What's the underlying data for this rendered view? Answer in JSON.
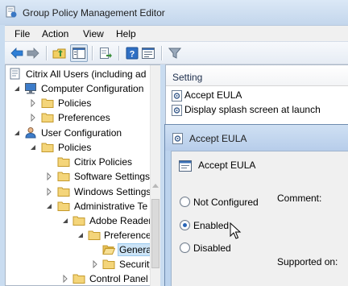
{
  "window": {
    "title": "Group Policy Management Editor"
  },
  "menu": {
    "items": [
      "File",
      "Action",
      "View",
      "Help"
    ]
  },
  "toolbar": {
    "buttons": [
      "back-arrow-icon",
      "forward-arrow-icon",
      "up-folder-icon",
      "show-hide-tree-icon",
      "export-list-icon",
      "help-icon",
      "properties-icon",
      "filter-icon"
    ]
  },
  "tree": {
    "items": [
      {
        "label": "Citrix All Users (including ad",
        "icon": "policy-scroll-icon",
        "expanded": true
      },
      {
        "label": "Computer Configuration",
        "icon": "computer-icon",
        "expanded": true
      },
      {
        "label": "Policies",
        "icon": "folder-icon",
        "expanded": false
      },
      {
        "label": "Preferences",
        "icon": "folder-icon",
        "expanded": false
      },
      {
        "label": "User Configuration",
        "icon": "user-icon",
        "expanded": true
      },
      {
        "label": "Policies",
        "icon": "folder-icon",
        "expanded": true
      },
      {
        "label": "Citrix Policies",
        "icon": "folder-icon",
        "expanded": null
      },
      {
        "label": "Software Settings",
        "icon": "folder-icon",
        "expanded": false
      },
      {
        "label": "Windows Settings",
        "icon": "folder-icon",
        "expanded": false
      },
      {
        "label": "Administrative Te",
        "icon": "folder-icon",
        "expanded": true
      },
      {
        "label": "Adobe Reader",
        "icon": "folder-icon",
        "expanded": true
      },
      {
        "label": "Preferences",
        "icon": "folder-icon",
        "expanded": true
      },
      {
        "label": "General",
        "icon": "folder-icon",
        "expanded": null,
        "selected": true
      },
      {
        "label": "Security",
        "icon": "folder-icon",
        "expanded": false
      },
      {
        "label": "Control Panel",
        "icon": "folder-icon",
        "expanded": false
      }
    ]
  },
  "settings": {
    "column_header": "Setting",
    "rows": [
      {
        "label": "Accept EULA",
        "icon": "setting-icon"
      },
      {
        "label": "Display splash screen at launch",
        "icon": "setting-icon"
      }
    ]
  },
  "dialog": {
    "title": "Accept EULA",
    "heading": "Accept EULA",
    "options": [
      {
        "label": "Not Configured",
        "checked": false
      },
      {
        "label": "Enabled",
        "checked": true
      },
      {
        "label": "Disabled",
        "checked": false
      }
    ],
    "comment_label": "Comment:",
    "supported_label": "Supported on:"
  },
  "colors": {
    "accent": "#2a66b8",
    "selection": "#cce4f7",
    "frame": "#c9dcf0"
  }
}
